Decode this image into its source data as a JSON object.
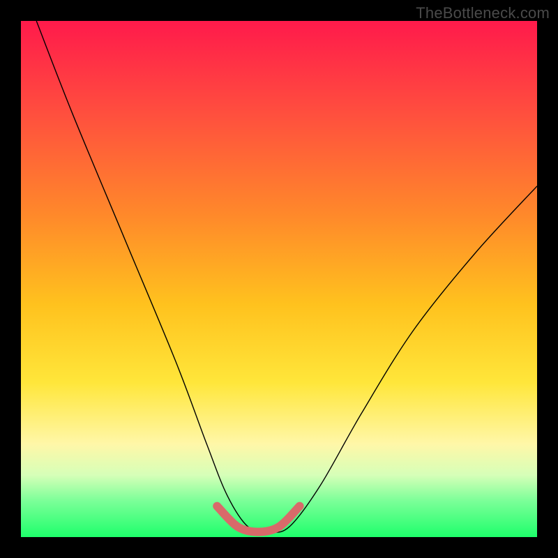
{
  "watermark": "TheBottleneck.com",
  "chart_data": {
    "type": "line",
    "title": "",
    "xlabel": "",
    "ylabel": "",
    "xlim": [
      0,
      100
    ],
    "ylim": [
      0,
      100
    ],
    "grid": false,
    "legend": false,
    "series": [
      {
        "name": "bottleneck-curve",
        "color": "#000000",
        "x": [
          3,
          10,
          20,
          30,
          36,
          40,
          44,
          48,
          52,
          58,
          66,
          76,
          88,
          100
        ],
        "y": [
          100,
          82,
          58,
          34,
          18,
          8,
          2,
          1,
          2,
          10,
          24,
          40,
          55,
          68
        ]
      },
      {
        "name": "optimal-highlight",
        "color": "#d86a6a",
        "x": [
          38,
          42,
          46,
          50,
          54
        ],
        "y": [
          6,
          2,
          1,
          2,
          6
        ]
      }
    ],
    "annotations": []
  }
}
